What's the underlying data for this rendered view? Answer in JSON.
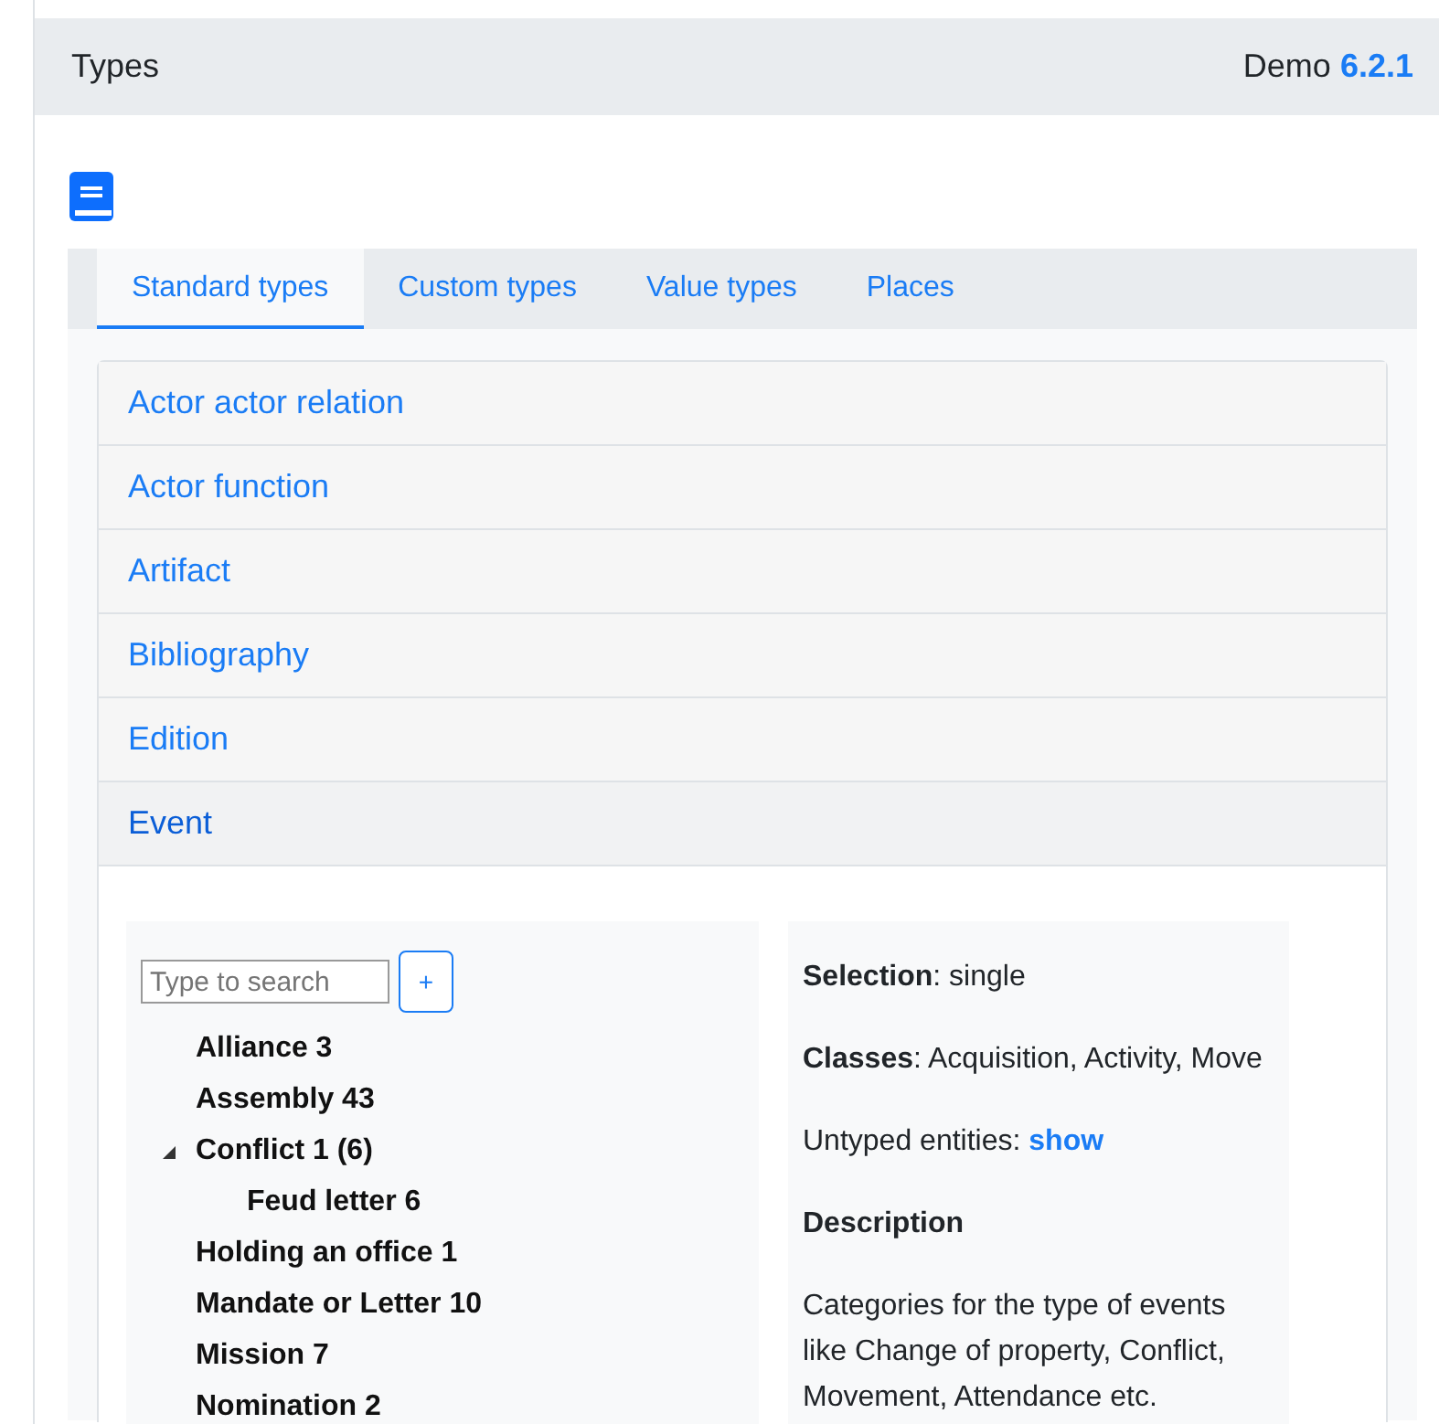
{
  "header": {
    "title": "Types",
    "product": "Demo",
    "version": "6.2.1"
  },
  "tabs": [
    {
      "label": "Standard types",
      "selected": true
    },
    {
      "label": "Custom types",
      "selected": false
    },
    {
      "label": "Value types",
      "selected": false
    },
    {
      "label": "Places",
      "selected": false
    }
  ],
  "accordion": [
    {
      "label": "Actor actor relation",
      "expanded": false
    },
    {
      "label": "Actor function",
      "expanded": false
    },
    {
      "label": "Artifact",
      "expanded": false
    },
    {
      "label": "Bibliography",
      "expanded": false
    },
    {
      "label": "Edition",
      "expanded": false
    },
    {
      "label": "Event",
      "expanded": true
    }
  ],
  "tree": {
    "search": {
      "placeholder": "Type to search"
    },
    "add_button": "+",
    "items": [
      {
        "label": "Alliance 3"
      },
      {
        "label": "Assembly 43"
      },
      {
        "label": "Conflict 1 (6)",
        "expanded": true,
        "children": [
          {
            "label": "Feud letter 6"
          }
        ]
      },
      {
        "label": "Holding an office 1"
      },
      {
        "label": "Mandate or Letter 10"
      },
      {
        "label": "Mission 7"
      },
      {
        "label": "Nomination 2"
      }
    ]
  },
  "info": {
    "selection": "**Selection**: single",
    "classes": "**Classes**: Acquisition, Activity, Move",
    "untyped_label": "Untyped entities:",
    "untyped_link": "show",
    "description_title": "Description",
    "description": "Categories for the type of events like Change of property, Conflict, Movement, Attendance etc."
  }
}
